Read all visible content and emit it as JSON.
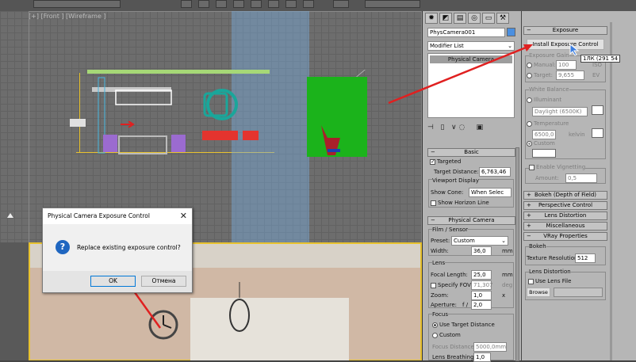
{
  "viewport_top_label": "[+] [Front ] [Wireframe ]",
  "dialog": {
    "title": "Physical Camera Exposure Control",
    "message": "Replace existing exposure control?",
    "ok": "OK",
    "cancel": "Отмена",
    "icon": "question-icon"
  },
  "command_panel": {
    "tabs": [
      "create-icon",
      "modify-icon",
      "hierarchy-icon",
      "motion-icon",
      "display-icon",
      "utilities-icon"
    ],
    "object_name": "PhysCamera001",
    "modifier_list": "Modifier List",
    "stack_item": "Physical Camera",
    "basic": {
      "header": "Basic",
      "targeted": "Targeted",
      "target_distance_label": "Target Distance:",
      "target_distance": "6,763,46",
      "viewport_display": "Viewport Display",
      "show_cone_label": "Show Cone:",
      "show_cone_value": "When Selec",
      "show_horizon": "Show Horizon Line"
    },
    "physical": {
      "header": "Physical Camera",
      "film_sensor": "Film / Sensor",
      "preset_label": "Preset:",
      "preset_value": "Custom",
      "width_label": "Width:",
      "width_value": "36,0",
      "width_unit": "mm",
      "lens": "Lens",
      "focal_label": "Focal Length:",
      "focal_value": "25,0",
      "focal_unit": "mm",
      "specify_fov": "Specify FOV:",
      "fov_value": "71,307",
      "fov_unit": "deg",
      "zoom_label": "Zoom:",
      "zoom_value": "1,0",
      "zoom_unit": "x",
      "aperture_label": "Aperture:",
      "aperture_f": "f /",
      "aperture_value": "2,0",
      "focus": "Focus",
      "use_target_distance": "Use Target Distance",
      "custom": "Custom",
      "focus_distance_label": "Focus Distance:",
      "focus_distance_value": "5000,0mm",
      "lens_breathing_label": "Lens Breathing:",
      "lens_breathing_value": "1,0"
    }
  },
  "exposure_panel": {
    "header": "Exposure",
    "install_btn": "Install Exposure Control",
    "exposure_gain": "Exposure Gain",
    "manual": "Manual:",
    "manual_value": "100",
    "manual_unit": "ISO",
    "target": "Target:",
    "target_value": "9,655",
    "target_unit": "EV",
    "white_balance": "White Balance",
    "illuminant": "Illuminant",
    "illuminant_value": "Daylight (6500K)",
    "temperature": "Temperature",
    "temperature_value": "6500,0",
    "temperature_unit": "kelvin",
    "custom": "Custom",
    "enable_vignetting": "Enable Vignetting",
    "amount_label": "Amount:",
    "amount_value": "0,5",
    "rollouts": [
      "Bokeh (Depth of Field)",
      "Perspective Control",
      "Lens Distortion",
      "Miscellaneous",
      "VRay Properties"
    ],
    "bokeh_group": "Bokeh",
    "texture_resolution_label": "Texture Resolution",
    "texture_resolution_value": "512",
    "lens_distortion_group": "Lens Distortion",
    "use_lens_file": "Use Lens File",
    "browse": "Browse"
  },
  "tooltip": "1ЛК (291 54",
  "colors": {
    "annotation_arrow": "#e02020",
    "selection": "#e8c22e",
    "cursor": "#3a7de0"
  }
}
